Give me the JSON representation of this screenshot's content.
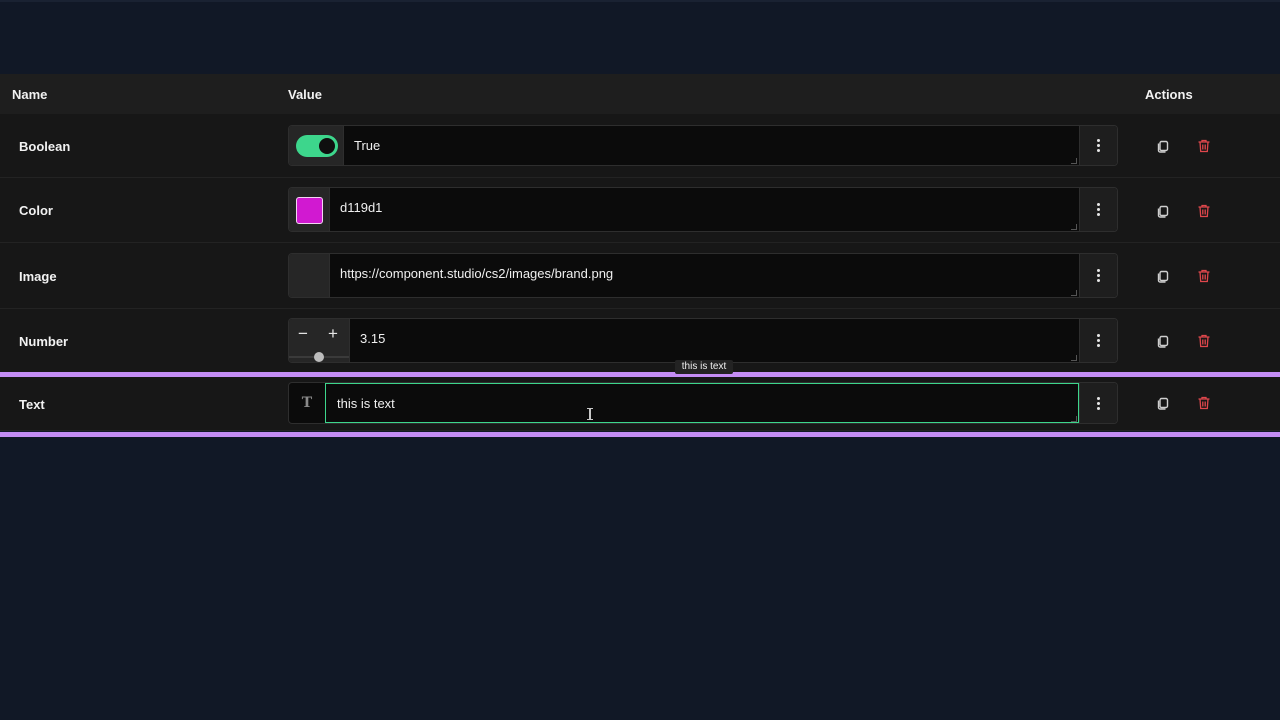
{
  "table": {
    "headers": {
      "name": "Name",
      "value": "Value",
      "actions": "Actions"
    },
    "rows": [
      {
        "label": "Boolean",
        "type": "boolean",
        "value": "True",
        "toggle_on": true
      },
      {
        "label": "Color",
        "type": "color",
        "value": "d119d1",
        "swatch_color": "#d119d1"
      },
      {
        "label": "Image",
        "type": "image",
        "value": "https://component.studio/cs2/images/brand.png"
      },
      {
        "label": "Number",
        "type": "number",
        "value": "3.15",
        "slider_fraction": 0.5
      },
      {
        "label": "Text",
        "type": "text",
        "value": "this is text"
      }
    ]
  },
  "tooltip": {
    "text": "this is text"
  },
  "icons": {
    "menu": "more-vertical-icon",
    "copy": "copy-icon",
    "delete": "trash-icon",
    "text_type": "T",
    "minus": "−",
    "plus": "+"
  },
  "colors": {
    "background": "#111826",
    "toggle_on": "#3dd68c",
    "focus_border": "#3dd68c",
    "selection_outline": "#c48df5",
    "delete_icon": "#e0474c"
  }
}
